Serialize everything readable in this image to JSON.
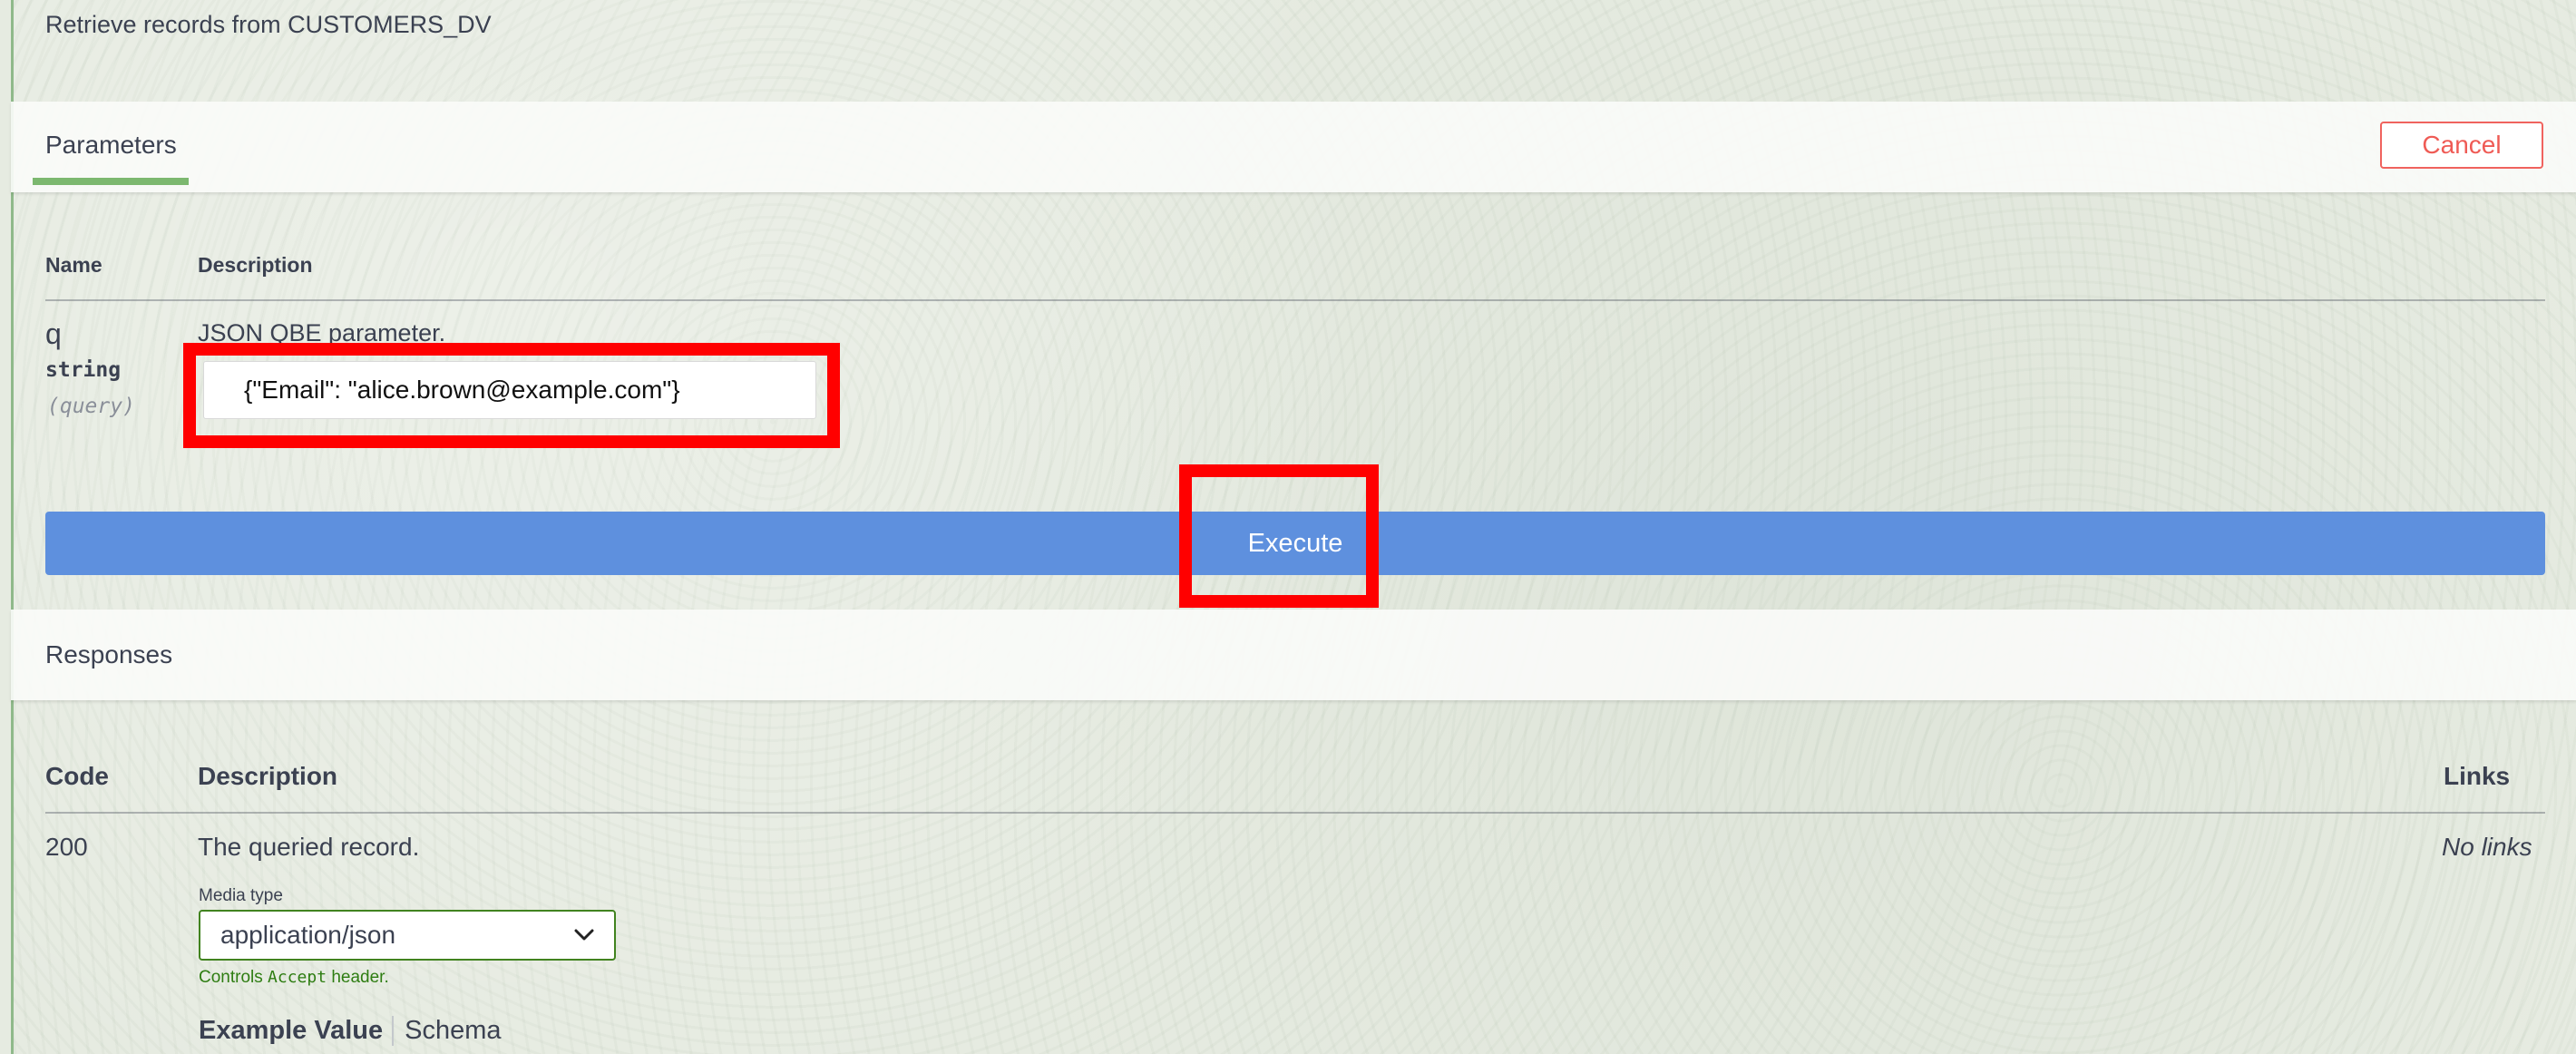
{
  "operation": {
    "summary": "Retrieve records from CUSTOMERS_DV"
  },
  "parameters_section": {
    "tab_label": "Parameters",
    "cancel_label": "Cancel",
    "columns": {
      "name": "Name",
      "description": "Description"
    },
    "params": [
      {
        "name": "q",
        "type": "string",
        "in": "(query)",
        "description": "JSON QBE parameter.",
        "value": "{\"Email\": \"alice.brown@example.com\"}"
      }
    ],
    "execute_label": "Execute"
  },
  "responses_section": {
    "title": "Responses",
    "columns": {
      "code": "Code",
      "description": "Description",
      "links": "Links"
    },
    "rows": [
      {
        "code": "200",
        "description": "The queried record.",
        "links": "No links",
        "media_type_label": "Media type",
        "media_type_value": "application/json",
        "controls_prefix": "Controls ",
        "controls_code": "Accept",
        "controls_suffix": " header.",
        "example_value_tab": "Example Value",
        "schema_tab": "Schema"
      }
    ]
  },
  "colors": {
    "execute": "#5e90de",
    "cancel": "#ef5b55",
    "accent_green": "#7cb86f",
    "highlight": "#ff0000"
  },
  "icons": {
    "select_caret": "chevron-down-icon"
  }
}
